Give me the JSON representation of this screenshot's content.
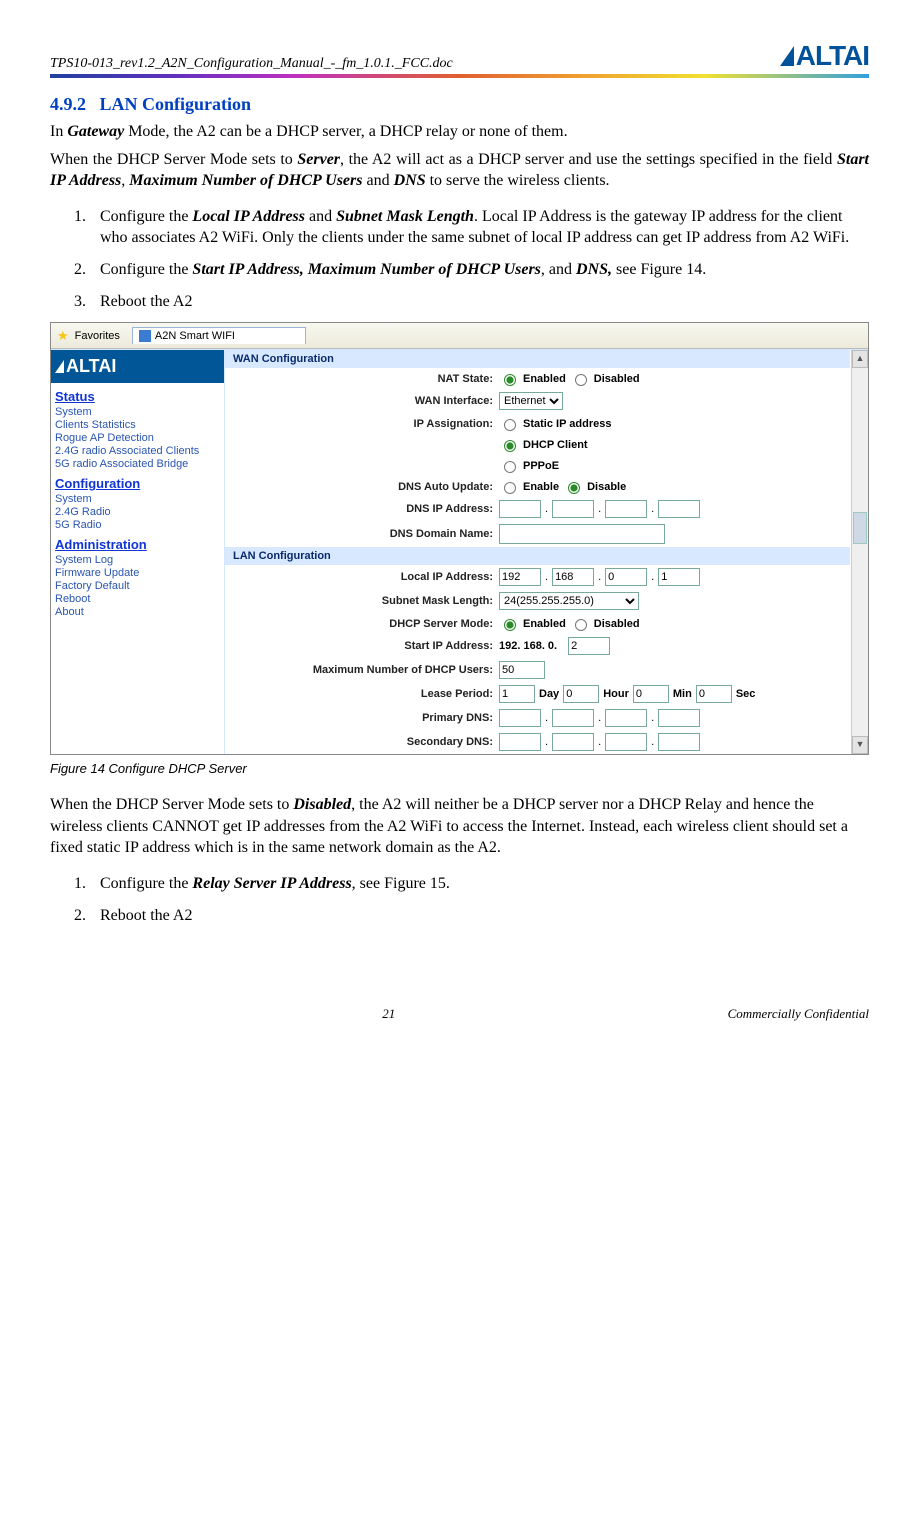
{
  "doc": {
    "filename": "TPS10-013_rev1.2_A2N_Configuration_Manual_-_fm_1.0.1._FCC.doc",
    "brand": "ALTAI",
    "page_number": "21",
    "confidential": "Commercially Confidential"
  },
  "content": {
    "section_number": "4.9.2",
    "section_title": "LAN Configuration",
    "para1_a": "In ",
    "para1_b": "Gateway",
    "para1_c": " Mode, the A2 can be a DHCP server, a DHCP relay or none of them.",
    "para2_a": "When the DHCP Server Mode sets to ",
    "para2_b": "Server",
    "para2_c": ", the A2 will act as a DHCP server and use the settings specified in the field ",
    "para2_d": "Start IP Address",
    "para2_e": ", ",
    "para2_f": "Maximum Number of DHCP Users",
    "para2_g": " and ",
    "para2_h": "DNS",
    "para2_i": " to serve the wireless clients.",
    "step1_a": "Configure the ",
    "step1_b": "Local IP Address",
    "step1_c": " and ",
    "step1_d": "Subnet Mask Length",
    "step1_e": ". Local IP Address is the gateway IP address for the client who associates A2 WiFi. Only the clients under the same subnet of local IP address can get IP address from A2 WiFi.",
    "step2_a": "Configure the ",
    "step2_b": "Start IP Address, Maximum Number of DHCP Users",
    "step2_c": ", and ",
    "step2_d": "DNS,",
    "step2_e": " see Figure 14.",
    "step3": "Reboot the A2",
    "figcaption": "Figure 14     Configure DHCP Server",
    "para3_a": "When the DHCP Server Mode sets to ",
    "para3_b": "Disabled",
    "para3_c": ", the A2 will neither be a DHCP server nor a DHCP Relay and hence the wireless clients CANNOT get IP addresses from the A2   WiFi to access the Internet. Instead, each wireless client should set a fixed static IP address which is in the same network domain as the A2.",
    "stepB1_a": "Configure the ",
    "stepB1_b": "Relay Server IP Address",
    "stepB1_c": ", see Figure 15.",
    "stepB2": "Reboot the A2"
  },
  "shot": {
    "favorites": "Favorites",
    "tab_title": "A2N Smart WIFI",
    "sidebar_brand": "ALTAI",
    "groups": {
      "status": {
        "head": "Status",
        "items": [
          "System",
          "Clients Statistics",
          "Rogue AP Detection",
          "2.4G radio Associated Clients",
          "5G radio Associated Bridge"
        ]
      },
      "config": {
        "head": "Configuration",
        "items": [
          "System",
          "2.4G Radio",
          "5G Radio"
        ]
      },
      "admin": {
        "head": "Administration",
        "items": [
          "System Log",
          "Firmware Update",
          "Factory Default",
          "Reboot",
          "About"
        ]
      }
    },
    "wan": {
      "title": "WAN Configuration",
      "nat_label": "NAT State:",
      "nat_enabled": "Enabled",
      "nat_disabled": "Disabled",
      "wanif_label": "WAN Interface:",
      "wanif_value": "Ethernet",
      "ipassign_label": "IP Assignation:",
      "ipassign_static": "Static IP address",
      "ipassign_dhcp": "DHCP Client",
      "ipassign_pppoe": "PPPoE",
      "dnsauto_label": "DNS Auto Update:",
      "dnsauto_enable": "Enable",
      "dnsauto_disable": "Disable",
      "dnsip_label": "DNS IP Address:",
      "dnsdomain_label": "DNS Domain Name:"
    },
    "lan": {
      "title": "LAN Configuration",
      "localip_label": "Local IP Address:",
      "localip": [
        "192",
        "168",
        "0",
        "1"
      ],
      "mask_label": "Subnet Mask Length:",
      "mask_value": "24(255.255.255.0)",
      "dhcpmode_label": "DHCP Server Mode:",
      "dhcp_enabled": "Enabled",
      "dhcp_disabled": "Disabled",
      "startip_label": "Start IP Address:",
      "startip_prefix": "192. 168. 0.",
      "startip_last": "2",
      "maxusers_label": "Maximum Number of DHCP Users:",
      "maxusers": "50",
      "lease_label": "Lease Period:",
      "lease_day": "1",
      "lease_day_u": "Day",
      "lease_hour": "0",
      "lease_hour_u": "Hour",
      "lease_min": "0",
      "lease_min_u": "Min",
      "lease_sec": "0",
      "lease_sec_u": "Sec",
      "pdns_label": "Primary DNS:",
      "sdns_label": "Secondary DNS:"
    }
  }
}
